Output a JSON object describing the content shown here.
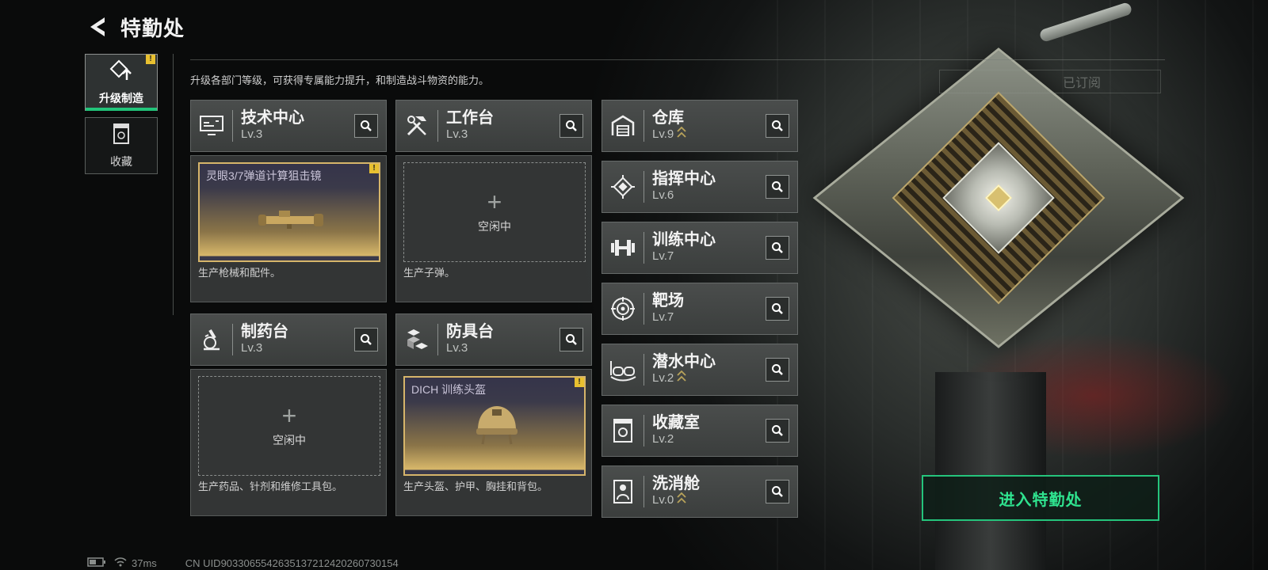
{
  "header": {
    "title": "特勤处"
  },
  "nav": [
    {
      "label": "升级制造",
      "badge": "!",
      "icon": "upgrade-icon"
    },
    {
      "label": "收藏",
      "icon": "collection-icon"
    }
  ],
  "description": "升级各部门等级，可获得专属能力提升，和制造战斗物资的能力。",
  "subscribe_label": "已订阅",
  "departments": [
    {
      "name": "技术中心",
      "level": "Lv.3",
      "icon": "computer-icon",
      "state": "crafting",
      "item": "灵眼3/7弹道计算狙击镜",
      "item_badge": "!",
      "footer": "生产枪械和配件。"
    },
    {
      "name": "工作台",
      "level": "Lv.3",
      "icon": "tools-icon",
      "state": "idle",
      "idle_label": "空闲中",
      "footer": "生产子弹。"
    },
    {
      "name": "制药台",
      "level": "Lv.3",
      "icon": "microscope-icon",
      "state": "idle",
      "idle_label": "空闲中",
      "footer": "生产药品、针剂和维修工具包。"
    },
    {
      "name": "防具台",
      "level": "Lv.3",
      "icon": "armor-boxes-icon",
      "state": "crafting",
      "item": "DICH 训练头盔",
      "item_badge": "!",
      "footer": "生产头盔、护甲、胸挂和背包。"
    }
  ],
  "facilities": [
    {
      "name": "仓库",
      "level": "Lv.9",
      "icon": "warehouse-icon",
      "upgradable": true
    },
    {
      "name": "指挥中心",
      "level": "Lv.6",
      "icon": "chip-icon",
      "upgradable": false
    },
    {
      "name": "训练中心",
      "level": "Lv.7",
      "icon": "dumbbell-icon",
      "upgradable": false
    },
    {
      "name": "靶场",
      "level": "Lv.7",
      "icon": "target-icon",
      "upgradable": false
    },
    {
      "name": "潜水中心",
      "level": "Lv.2",
      "icon": "goggles-icon",
      "upgradable": true
    },
    {
      "name": "收藏室",
      "level": "Lv.2",
      "icon": "collection-room-icon",
      "upgradable": false
    },
    {
      "name": "洗消舱",
      "level": "Lv.0",
      "icon": "decon-icon",
      "upgradable": true
    }
  ],
  "enter_button": "进入特勤处",
  "status": {
    "ping": "37ms",
    "uid": "CN UID9033065542635137212420260730154"
  },
  "colors": {
    "accent": "#25c47c",
    "badge": "#e8c030",
    "craft_border": "#d6b56a"
  }
}
